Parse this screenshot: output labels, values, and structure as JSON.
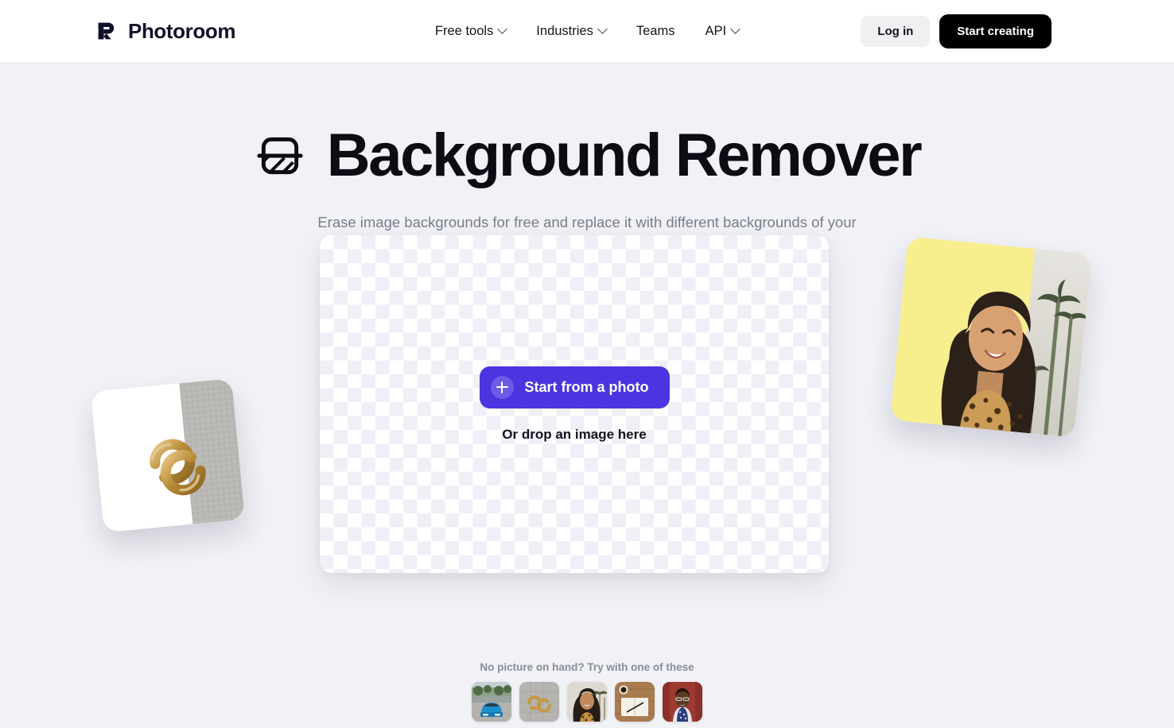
{
  "header": {
    "brand_name": "Photoroom",
    "brand_logo_icon": "photoroom-r-logo",
    "nav": [
      {
        "label": "Free tools",
        "has_dropdown": true
      },
      {
        "label": "Industries",
        "has_dropdown": true
      },
      {
        "label": "Teams",
        "has_dropdown": false
      },
      {
        "label": "API",
        "has_dropdown": true
      }
    ],
    "login_label": "Log in",
    "start_creating_label": "Start creating"
  },
  "hero": {
    "title": "Background Remover",
    "title_icon": "background-remove-icon",
    "subtitle": "Erase image backgrounds for free and replace it with different backgrounds of your choosing."
  },
  "dropzone": {
    "primary_button_label": "Start from a photo",
    "primary_button_icon": "plus-icon",
    "drop_hint": "Or drop an image here",
    "accent_color": "#4b35e0"
  },
  "samples": {
    "label": "No picture on hand? Try with one of these",
    "items": [
      {
        "name": "blue-car-sample"
      },
      {
        "name": "gold-earrings-sample"
      },
      {
        "name": "smiling-woman-palms-sample"
      },
      {
        "name": "notebook-desk-sample"
      },
      {
        "name": "woman-patterned-vest-sample"
      }
    ]
  },
  "floating_previews": [
    {
      "name": "earrings-before-after-card",
      "position": "left"
    },
    {
      "name": "woman-yellow-background-card",
      "position": "right"
    }
  ],
  "theme": {
    "page_background": "#f1f2f6",
    "header_background": "#ffffff",
    "text_primary": "#0c0c14",
    "text_muted": "#7b7d8c"
  }
}
